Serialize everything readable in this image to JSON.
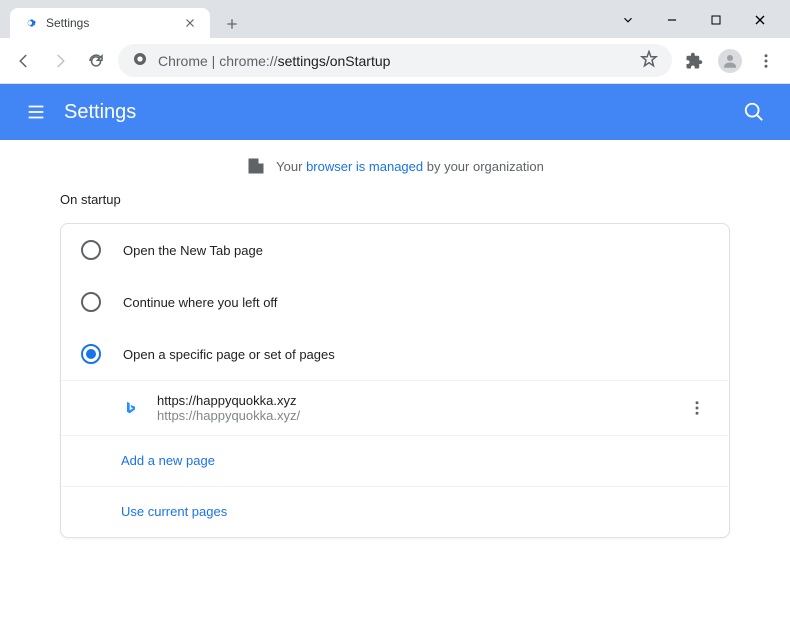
{
  "titlebar": {
    "tab_title": "Settings"
  },
  "addressbar": {
    "prefix": "Chrome",
    "separator": " | ",
    "host": "chrome://",
    "path": "settings/onStartup"
  },
  "header": {
    "title": "Settings"
  },
  "banner": {
    "prefix": "Your ",
    "link": "browser is managed",
    "suffix": " by your organization"
  },
  "section": {
    "title": "On startup"
  },
  "options": {
    "new_tab": "Open the New Tab page",
    "continue": "Continue where you left off",
    "specific": "Open a specific page or set of pages"
  },
  "page_entry": {
    "title": "https://happyquokka.xyz",
    "url": "https://happyquokka.xyz/"
  },
  "actions": {
    "add_page": "Add a new page",
    "use_current": "Use current pages"
  }
}
